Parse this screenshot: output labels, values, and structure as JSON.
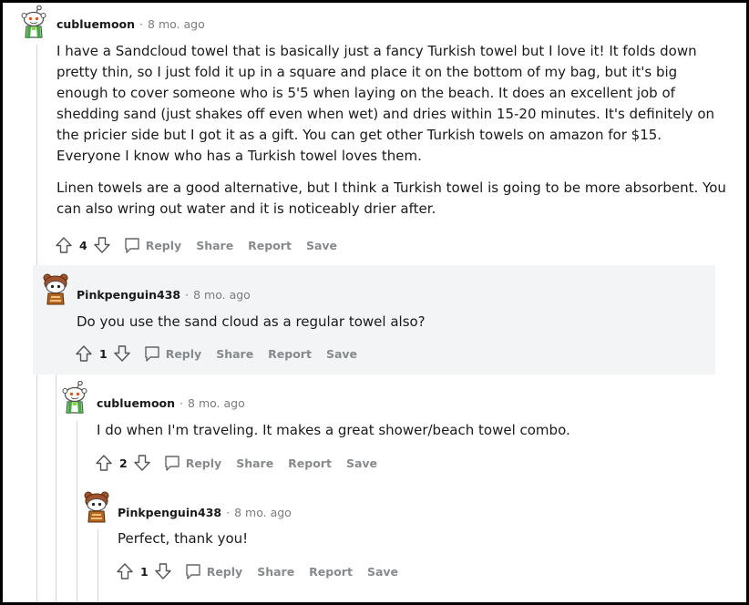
{
  "comments": [
    {
      "user": "cubluemoon",
      "time": "8 mo. ago",
      "avatar_icon": "snoo-avatar-green-scarf-icon",
      "paragraphs": [
        "I have a Sandcloud towel that is basically just a fancy Turkish towel but I love it! It folds down pretty thin, so I just fold it up in a square and place it on the bottom of my bag, but it's big enough to cover someone who is 5'5 when laying on the beach. It does an excellent job of shedding sand (just shakes off even when wet) and dries within 15-20 minutes. It's definitely on the pricier side but I got it as a gift. You can get other Turkish towels on amazon for $15. Everyone I know who has a Turkish towel loves them.",
        "Linen towels are a good alternative, but I think a Turkish towel is going to be more absorbent. You can also wring out water and it is noticeably drier after."
      ],
      "votes": "4"
    },
    {
      "user": "Pinkpenguin438",
      "time": "8 mo. ago",
      "avatar_icon": "snoo-avatar-brown-bear-hat-icon",
      "paragraphs": [
        "Do you use the sand cloud as a regular towel also?"
      ],
      "votes": "1"
    },
    {
      "user": "cubluemoon",
      "time": "8 mo. ago",
      "avatar_icon": "snoo-avatar-green-scarf-icon",
      "paragraphs": [
        "I do when I'm traveling. It makes a great shower/beach towel combo."
      ],
      "votes": "2"
    },
    {
      "user": "Pinkpenguin438",
      "time": "8 mo. ago",
      "avatar_icon": "snoo-avatar-brown-bear-hat-icon",
      "paragraphs": [
        "Perfect, thank you!"
      ],
      "votes": "1"
    }
  ],
  "actions": {
    "reply": "Reply",
    "share": "Share",
    "report": "Report",
    "save": "Save"
  },
  "meta_separator": "·",
  "colors": {
    "highlight_bg": "#f3f4f6",
    "thread_line": "#d3d6da",
    "action_text": "#878a8c"
  }
}
